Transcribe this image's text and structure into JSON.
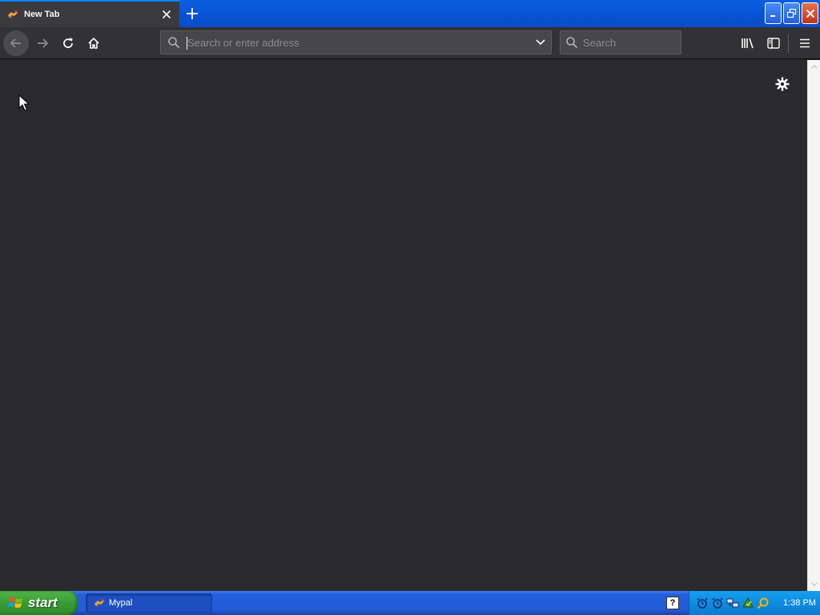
{
  "window": {
    "tab_title": "New Tab",
    "tab_close": "close-icon",
    "new_tab": "plus-icon",
    "controls": [
      "minimize",
      "restore",
      "close"
    ]
  },
  "toolbar": {
    "back": "back-arrow-icon",
    "forward": "forward-arrow-icon",
    "reload": "reload-icon",
    "home": "home-icon",
    "urlbar_placeholder": "Search or enter address",
    "urlbar_value": "",
    "search_placeholder": "Search",
    "library": "library-icon",
    "sidebar": "sidebar-icon",
    "menu": "hamburger-menu-icon"
  },
  "content": {
    "settings": "gear-icon",
    "background": "#2a2a2e"
  },
  "taskbar": {
    "start_label": "start",
    "task_item_label": "Mypal",
    "clock": "1:38 PM",
    "tray_icons": [
      "alarm-icon",
      "alarm-icon-2",
      "network-icon",
      "update-icon",
      "search-icon"
    ]
  },
  "colors": {
    "accent": "#0a84ff",
    "toolbar": "#323234",
    "xp_blue": "#245edb",
    "start_green": "#3a9a36"
  }
}
